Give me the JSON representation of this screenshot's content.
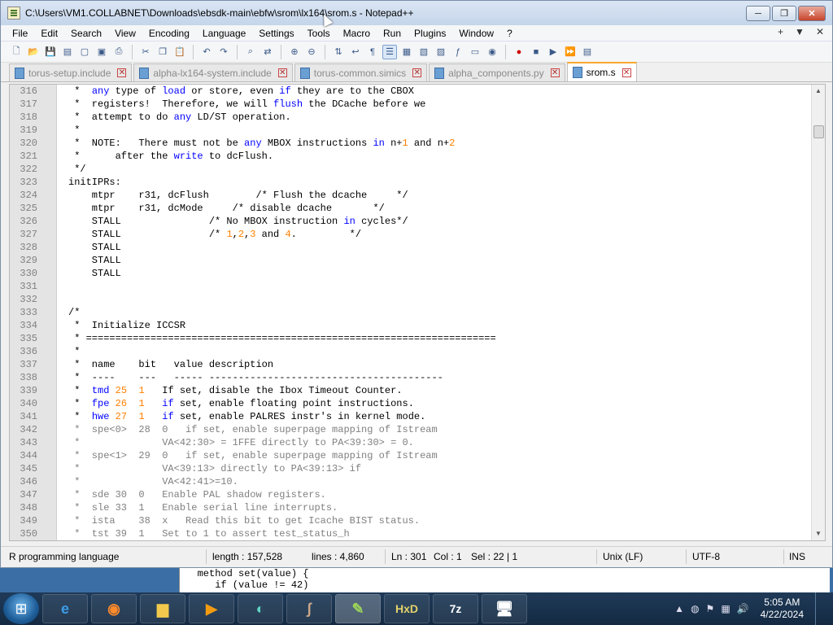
{
  "window": {
    "title": "C:\\Users\\VM1.COLLABNET\\Downloads\\ebsdk-main\\ebfw\\srom\\lx164\\srom.s - Notepad++",
    "minimize": "─",
    "maximize": "❐",
    "close": "✕"
  },
  "menu": {
    "items": [
      "File",
      "Edit",
      "Search",
      "View",
      "Encoding",
      "Language",
      "Settings",
      "Tools",
      "Macro",
      "Run",
      "Plugins",
      "Window",
      "?"
    ],
    "right": [
      "+",
      "▼",
      "✕"
    ]
  },
  "tabs": [
    {
      "label": "torus-setup.include",
      "active": false
    },
    {
      "label": "alpha-lx164-system.include",
      "active": false
    },
    {
      "label": "torus-common.simics",
      "active": false
    },
    {
      "label": "alpha_components.py",
      "active": false
    },
    {
      "label": "srom.s",
      "active": true
    }
  ],
  "editor": {
    "lines": [
      {
        "n": "316",
        "html": " *  <span class=\"kw\">any</span> type of <span class=\"kw\">load</span> or store, even <span class=\"kw\">if</span> they are to the CBOX"
      },
      {
        "n": "317",
        "html": " *  registers!  Therefore, we will <span class=\"kw\">flush</span> the DCache before we"
      },
      {
        "n": "318",
        "html": " *  attempt to do <span class=\"kw\">any</span> LD/ST operation."
      },
      {
        "n": "319",
        "html": " *"
      },
      {
        "n": "320",
        "html": " *  NOTE:   There must not be <span class=\"kw\">any</span> MBOX instructions <span class=\"kw\">in</span> n+<span class=\"num\">1</span> and n+<span class=\"num\">2</span>"
      },
      {
        "n": "321",
        "html": " *      after the <span class=\"kw\">write</span> to dcFlush."
      },
      {
        "n": "322",
        "html": " */"
      },
      {
        "n": "323",
        "html": "initIPRs:"
      },
      {
        "n": "324",
        "html": "    mtpr    r31, dcFlush        /* Flush the dcache     */"
      },
      {
        "n": "325",
        "html": "    mtpr    r31, dcMode     /* disable dcache       */"
      },
      {
        "n": "326",
        "html": "    STALL               /* No MBOX instruction <span class=\"kw\">in</span> cycles*/"
      },
      {
        "n": "327",
        "html": "    STALL               /* <span class=\"num\">1</span>,<span class=\"num\">2</span>,<span class=\"num\">3</span> and <span class=\"num\">4</span>.         */"
      },
      {
        "n": "328",
        "html": "    STALL"
      },
      {
        "n": "329",
        "html": "    STALL"
      },
      {
        "n": "330",
        "html": "    STALL"
      },
      {
        "n": "331",
        "html": ""
      },
      {
        "n": "332",
        "html": ""
      },
      {
        "n": "333",
        "html": "/*"
      },
      {
        "n": "334",
        "html": " *  Initialize ICCSR"
      },
      {
        "n": "335",
        "html": " * ======================================================================"
      },
      {
        "n": "336",
        "html": " *"
      },
      {
        "n": "337",
        "html": " *  name    bit   value description"
      },
      {
        "n": "338",
        "html": " *  ----    ---   ----- ----------------------------------------"
      },
      {
        "n": "339",
        "html": " *  <span class=\"kw\">tmd</span> <span class=\"num\">25</span>  <span class=\"num\">1</span>   If set, disable the Ibox Timeout Counter."
      },
      {
        "n": "340",
        "html": " *  <span class=\"kw\">fpe</span> <span class=\"num\">26</span>  <span class=\"num\">1</span>   <span class=\"kw\">if</span> set, enable floating point instructions."
      },
      {
        "n": "341",
        "html": " *  <span class=\"kw\">hwe</span> <span class=\"num\">27</span>  <span class=\"num\">1</span>   <span class=\"kw\">if</span> set, enable PALRES instr's in kernel mode."
      },
      {
        "n": "342",
        "html": "<span class=\"cm\"> *  spe&lt;0&gt;  28  0   if set, enable superpage mapping of Istream</span>"
      },
      {
        "n": "343",
        "html": "<span class=\"cm\"> *              VA&lt;42:30&gt; = 1FFE directly to PA&lt;39:30&gt; = 0.</span>"
      },
      {
        "n": "344",
        "html": "<span class=\"cm\"> *  spe&lt;1&gt;  29  0   if set, enable superpage mapping of Istream</span>"
      },
      {
        "n": "345",
        "html": "<span class=\"cm\"> *              VA&lt;39:13&gt; directly to PA&lt;39:13&gt; if</span>"
      },
      {
        "n": "346",
        "html": "<span class=\"cm\"> *              VA&lt;42:41&gt;=10.</span>"
      },
      {
        "n": "347",
        "html": "<span class=\"cm\"> *  sde 30  0   Enable PAL shadow registers.</span>"
      },
      {
        "n": "348",
        "html": "<span class=\"cm\"> *  sle 33  1   Enable serial line interrupts.</span>"
      },
      {
        "n": "349",
        "html": "<span class=\"cm\"> *  ista    38  x   Read this bit to get Icache BIST status.</span>"
      },
      {
        "n": "350",
        "html": "<span class=\"cm\"> *  tst 39  1   Set to 1 to assert test_status_h</span>"
      }
    ]
  },
  "status": {
    "language": "R programming language",
    "length": "length : 157,528",
    "lines": "lines : 4,860",
    "ln": "Ln : 301",
    "col": "Col : 1",
    "sel": "Sel : 22 | 1",
    "eol": "Unix (LF)",
    "encoding": "UTF-8",
    "mode": "INS"
  },
  "background_peek": {
    "line1": "   method set(value) {",
    "line2": "      if (value != 42)"
  },
  "taskbar": {
    "apps": [
      "IE",
      "Firefox",
      "Explorer",
      "Media",
      "App",
      "Wireshark",
      "Notepad++",
      "HxD",
      "7z",
      "Remote"
    ],
    "clock_time": "5:05 AM",
    "clock_date": "4/22/2024"
  }
}
